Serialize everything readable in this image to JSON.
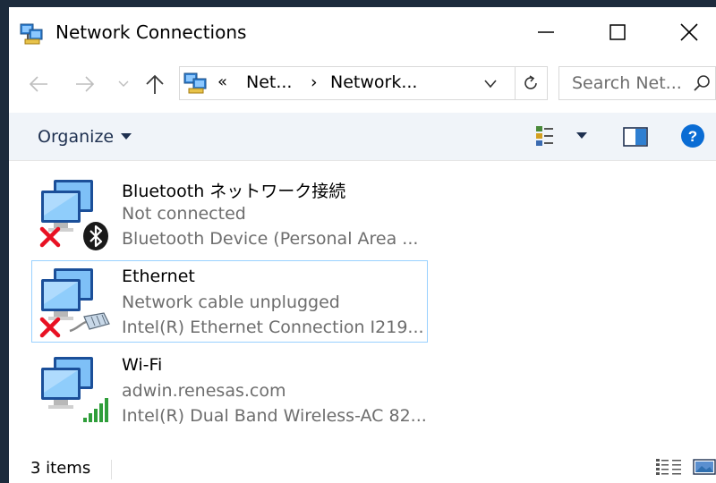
{
  "window": {
    "title": "Network Connections",
    "icons": {
      "app": "network-connections-icon",
      "minimize": "minimize-icon",
      "maximize": "maximize-icon",
      "close": "close-icon"
    }
  },
  "nav": {
    "icons": [
      "back-arrow-icon",
      "forward-arrow-icon",
      "recent-locations-chevron-icon",
      "up-arrow-icon"
    ]
  },
  "address": {
    "prefix": "«",
    "crumbs": [
      "Net...",
      "Network..."
    ],
    "separator": "›"
  },
  "search": {
    "placeholder": "Search Net..."
  },
  "toolbar": {
    "organize_label": "Organize",
    "icons": [
      "change-view-icon",
      "view-dropdown-icon",
      "preview-pane-icon",
      "help-icon"
    ]
  },
  "connections": [
    {
      "name": "Bluetooth ネットワーク接続",
      "status": "Not connected",
      "device": "Bluetooth Device (Personal Area ...",
      "badge": "bluetooth-icon",
      "error": true,
      "selected": false
    },
    {
      "name": "Ethernet",
      "status": "Network cable unplugged",
      "device": "Intel(R) Ethernet Connection I219...",
      "badge": "ethernet-cable-icon",
      "error": true,
      "selected": true
    },
    {
      "name": "Wi-Fi",
      "status": "adwin.renesas.com",
      "device": "Intel(R) Dual Band Wireless-AC 82...",
      "badge": "signal-bars-icon",
      "error": false,
      "selected": false
    }
  ],
  "status_bar": {
    "item_count": "3 items",
    "icons": [
      "details-view-icon",
      "large-icons-view-icon"
    ]
  },
  "colors": {
    "frame": "#1c2b3c",
    "accent": "#0078d7",
    "selection_border": "#99d1ff",
    "command_bar": "#f0f4f9",
    "secondary_text": "#6d6d6d",
    "error_red": "#e81123",
    "signal_green": "#2f9e3a"
  }
}
